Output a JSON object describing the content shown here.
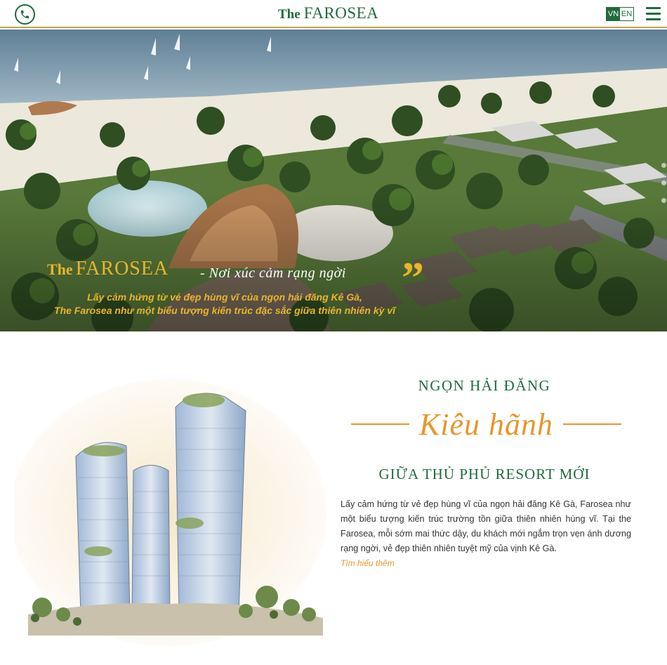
{
  "header": {
    "phone_icon": "phone-icon",
    "logo_the": "The",
    "logo_name": "FAROSEA",
    "lang_vn": "VN",
    "lang_en": "EN",
    "menu_icon": "hamburger-menu-icon"
  },
  "hero": {
    "brand_the": "The",
    "brand_name": "FAROSEA",
    "tagline": "- Nơi xúc cảm rạng ngời",
    "quote_mark": "”",
    "desc_line1": "Lấy cảm hứng từ vẻ đẹp hùng vĩ của ngọn hải đăng Kê Gà,",
    "desc_line2": "The Farosea như một biểu tượng kiến trúc đặc sắc giữa thiên nhiên kỳ vĩ"
  },
  "intro": {
    "heading_top": "NGỌN HẢI ĐĂNG",
    "script": "Kiêu hãnh",
    "heading_bottom": "GIỮA THỦ PHỦ RESORT MỚI",
    "body": "Lấy cảm hứng từ vẻ đẹp hùng vĩ của ngọn hải đăng Kê Gà, Farosea như một biểu tượng kiến trúc trường tồn giữa thiên nhiên hùng vĩ. Tại the Farosea, mỗi sớm mai thức dậy, du khách mới ngắm trọn vẹn ánh dương rạng ngời, vẻ đẹp thiên nhiên tuyệt mỹ của vịnh Kê Gà.",
    "learn_more": "Tìm hiểu thêm"
  },
  "colors": {
    "brand_green": "#1f6b3c",
    "gold": "#e8b52c",
    "orange": "#e8962a"
  }
}
